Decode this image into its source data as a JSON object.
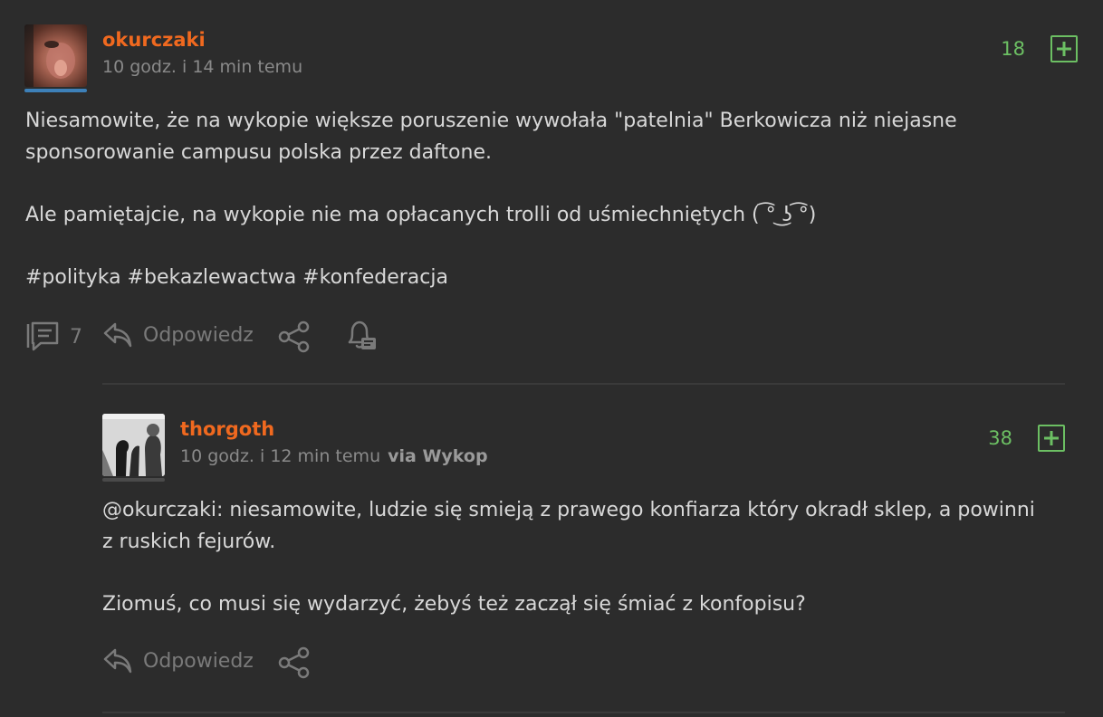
{
  "colors": {
    "background": "#2c2c2c",
    "username": "#f0691f",
    "score": "#6cbf63",
    "muted": "#7a7a7a"
  },
  "entry": {
    "username": "okurczaki",
    "time": "10 godz. i 14 min temu",
    "score": "18",
    "text_lines": [
      "Niesamowite, że na wykopie większe poruszenie wywołała \"patelnia\" Berkowicza niż niejasne",
      "sponsorowanie campusu polska przez daftone.",
      "",
      "Ale pamiętajcie, na wykopie nie ma opłacanych trolli od uśmiechniętych ( ͡° ͜ʖ ͡°)",
      "",
      "#polityka #bekazlewactwa #konfederacja"
    ],
    "comments_count": "7",
    "reply_label": "Odpowiedz",
    "icons": [
      "comments-icon",
      "reply-icon",
      "share-icon",
      "notification-icon"
    ]
  },
  "comment": {
    "username": "thorgoth",
    "time": "10 godz. i 12 min temu",
    "via": "via Wykop",
    "score": "38",
    "text_lines": [
      "@okurczaki: niesamowite, ludzie się smieją z prawego konfiarza który okradł sklep, a powinni",
      "z ruskich fejurów.",
      "",
      "Ziomuś, co musi się wydarzyć, żebyś też zaczął się śmiać z konfopisu?"
    ],
    "reply_label": "Odpowiedz",
    "icons": [
      "reply-icon",
      "share-icon"
    ]
  }
}
